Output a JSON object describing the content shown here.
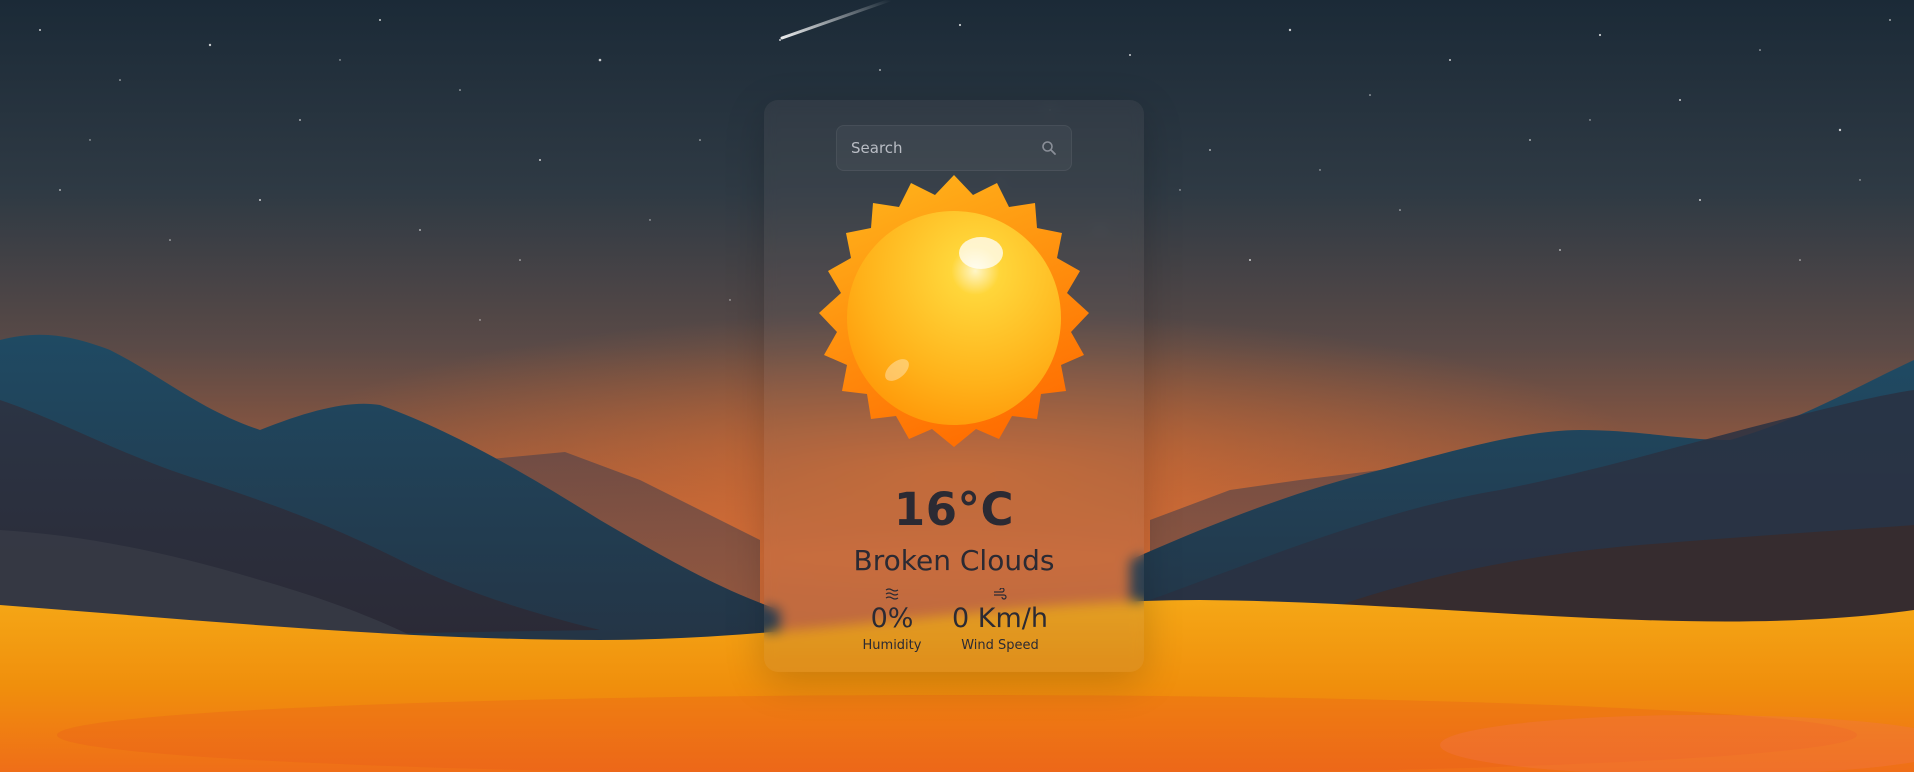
{
  "search": {
    "placeholder": "Search",
    "icon": "search-icon"
  },
  "weather": {
    "icon": "sun-icon",
    "temperature": "16°C",
    "condition": "Broken Clouds"
  },
  "stats": {
    "humidity": {
      "icon": "humidity-icon",
      "value": "0%",
      "label": "Humidity"
    },
    "wind": {
      "icon": "wind-icon",
      "value": "0 Km/h",
      "label": "Wind Speed"
    }
  },
  "colors": {
    "sky_top": "#1c2a38",
    "sky_bottom": "#c0643a",
    "sand": "#f0920f",
    "sun_core": "#ffc61e",
    "sun_rays": "#ff8a00",
    "text": "#2b2a33"
  }
}
